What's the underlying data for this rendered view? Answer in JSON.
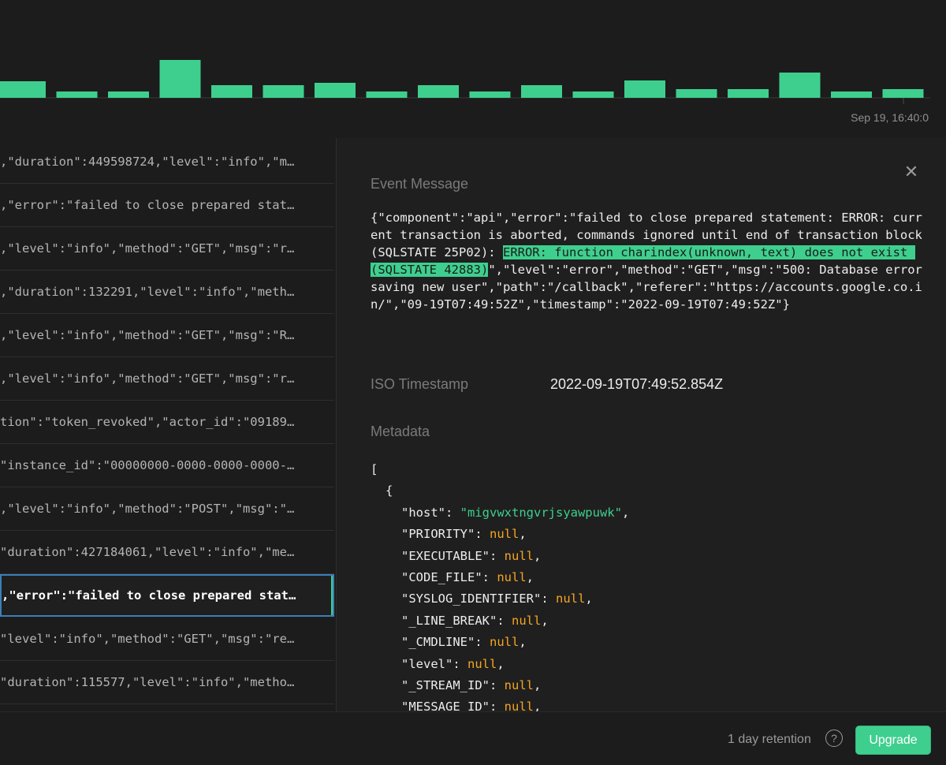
{
  "chart": {
    "date_label": "Sep 19, 16:40:0",
    "bar_color": "#3ecf8e"
  },
  "chart_data": {
    "type": "bar",
    "values": [
      21,
      8,
      8,
      48,
      16,
      16,
      19,
      8,
      16,
      8,
      16,
      8,
      22,
      11,
      11,
      32,
      8,
      11
    ],
    "xlabel": "",
    "ylabel": ""
  },
  "log_rows": [
    ",\"duration\":449598724,\"level\":\"info\",\"m…",
    ",\"error\":\"failed to close prepared stat…",
    ",\"level\":\"info\",\"method\":\"GET\",\"msg\":\"r…",
    ",\"duration\":132291,\"level\":\"info\",\"meth…",
    ",\"level\":\"info\",\"method\":\"GET\",\"msg\":\"R…",
    ",\"level\":\"info\",\"method\":\"GET\",\"msg\":\"r…",
    "tion\":\"token_revoked\",\"actor_id\":\"09189…",
    "\"instance_id\":\"00000000-0000-0000-0000-…",
    ",\"level\":\"info\",\"method\":\"POST\",\"msg\":\"…",
    "\"duration\":427184061,\"level\":\"info\",\"me…",
    ",\"error\":\"failed to close prepared stat…",
    "\"level\":\"info\",\"method\":\"GET\",\"msg\":\"re…",
    "\"duration\":115577,\"level\":\"info\",\"metho…",
    "\"level\":\"info\",\"method\":\"GET\",\"msg\":\"Re…"
  ],
  "selected_row_index": 10,
  "detail": {
    "event_message_label": "Event Message",
    "event_message_pre": "{\"component\":\"api\",\"error\":\"failed to close prepared statement: ERROR: current transaction is aborted, commands ignored until end of transaction block (SQLSTATE 25P02): ",
    "event_message_highlight": "ERROR: function charindex(unknown, text) does not exist (SQLSTATE 42883)",
    "event_message_post": "\",\"level\":\"error\",\"method\":\"GET\",\"msg\":\"500: Database error saving new user\",\"path\":\"/callback\",\"referer\":\"https://accounts.google.co.in/\",\"09-19T07:49:52Z\",\"timestamp\":\"2022-09-19T07:49:52Z\"}",
    "iso_label": "ISO Timestamp",
    "iso_value": "2022-09-19T07:49:52.854Z",
    "metadata_label": "Metadata",
    "metadata_open_bracket": "[",
    "metadata_open_brace": "{",
    "metadata_fields": [
      {
        "key": "\"host\"",
        "value": "\"migvwxtngvrjsyawpuwk\"",
        "kind": "str"
      },
      {
        "key": "\"PRIORITY\"",
        "value": "null",
        "kind": "null"
      },
      {
        "key": "\"EXECUTABLE\"",
        "value": "null",
        "kind": "null"
      },
      {
        "key": "\"CODE_FILE\"",
        "value": "null",
        "kind": "null"
      },
      {
        "key": "\"SYSLOG_IDENTIFIER\"",
        "value": "null",
        "kind": "null"
      },
      {
        "key": "\"_LINE_BREAK\"",
        "value": "null",
        "kind": "null"
      },
      {
        "key": "\"_CMDLINE\"",
        "value": "null",
        "kind": "null"
      },
      {
        "key": "\"level\"",
        "value": "null",
        "kind": "null"
      },
      {
        "key": "\"_STREAM_ID\"",
        "value": "null",
        "kind": "null"
      },
      {
        "key": "\"MESSAGE_ID\"",
        "value": "null",
        "kind": "null"
      }
    ]
  },
  "footer": {
    "retention": "1 day retention",
    "help_glyph": "?",
    "upgrade_label": "Upgrade"
  }
}
